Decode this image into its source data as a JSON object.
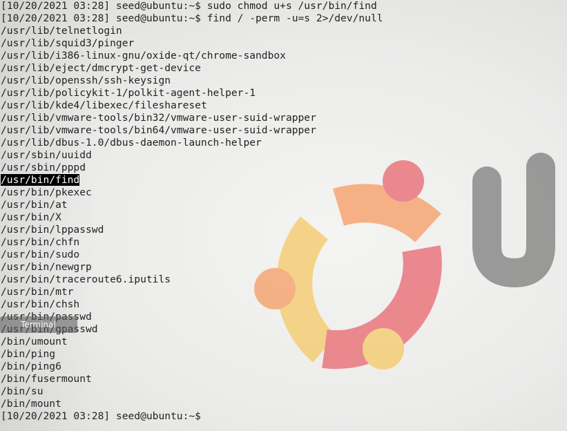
{
  "terminal": {
    "lines": [
      {
        "text": "[10/20/2021 03:28] seed@ubuntu:~$ sudo chmod u+s /usr/bin/find"
      },
      {
        "text": "[10/20/2021 03:28] seed@ubuntu:~$ find / -perm -u=s 2>/dev/null"
      },
      {
        "text": "/usr/lib/telnetlogin"
      },
      {
        "text": "/usr/lib/squid3/pinger"
      },
      {
        "text": "/usr/lib/i386-linux-gnu/oxide-qt/chrome-sandbox"
      },
      {
        "text": "/usr/lib/eject/dmcrypt-get-device"
      },
      {
        "text": "/usr/lib/openssh/ssh-keysign"
      },
      {
        "text": "/usr/lib/policykit-1/polkit-agent-helper-1"
      },
      {
        "text": "/usr/lib/kde4/libexec/fileshareset"
      },
      {
        "text": "/usr/lib/vmware-tools/bin32/vmware-user-suid-wrapper"
      },
      {
        "text": "/usr/lib/vmware-tools/bin64/vmware-user-suid-wrapper"
      },
      {
        "text": "/usr/lib/dbus-1.0/dbus-daemon-launch-helper"
      },
      {
        "text": "/usr/sbin/uuidd"
      },
      {
        "text": "/usr/sbin/pppd"
      },
      {
        "text": "/usr/bin/find"
      },
      {
        "text": "/usr/bin/pkexec"
      },
      {
        "text": "/usr/bin/at"
      },
      {
        "text": "/usr/bin/X"
      },
      {
        "text": "/usr/bin/lppasswd"
      },
      {
        "text": "/usr/bin/chfn"
      },
      {
        "text": "/usr/bin/sudo"
      },
      {
        "text": "/usr/bin/newgrp"
      },
      {
        "text": "/usr/bin/traceroute6.iputils"
      },
      {
        "text": "/usr/bin/mtr"
      },
      {
        "text": "/usr/bin/chsh"
      },
      {
        "text": "/usr/bin/passwd"
      },
      {
        "text": "/usr/bin/gpasswd"
      },
      {
        "text": "/bin/umount"
      },
      {
        "text": "/bin/ping"
      },
      {
        "text": "/bin/ping6"
      },
      {
        "text": "/bin/fusermount"
      },
      {
        "text": "/bin/su"
      },
      {
        "text": "/bin/mount"
      },
      {
        "text": "[10/20/2021 03:28] seed@ubuntu:~$ "
      }
    ],
    "selected_line_text": "/usr/bin/find"
  },
  "launcher_tooltip": {
    "label": "Terminal"
  },
  "wallpaper": {
    "logo_icon": "ubuntu-circle-of-friends-icon",
    "wordmark_fragment": "U",
    "colors": {
      "orange": "#f6a36e",
      "red": "#e9727a",
      "yellow": "#f5cd72",
      "wordmark": "#888888"
    }
  }
}
